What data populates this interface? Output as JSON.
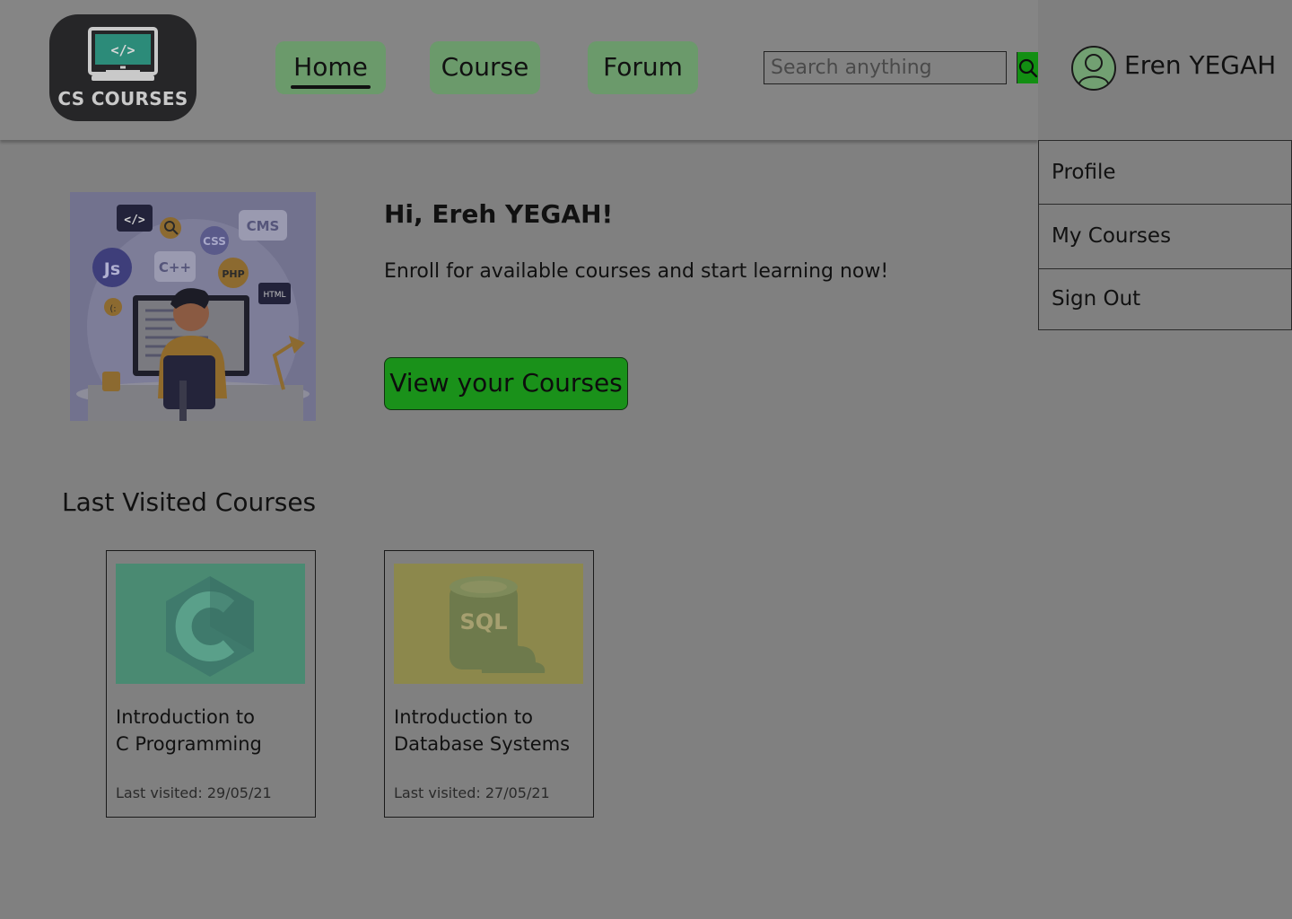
{
  "brand": {
    "logo_text": "CS COURSES"
  },
  "nav": {
    "home": "Home",
    "course": "Course",
    "forum": "Forum"
  },
  "search": {
    "placeholder": "Search anything"
  },
  "user": {
    "name": "Eren YEGAH",
    "menu": [
      "Profile",
      "My Courses",
      "Sign Out"
    ]
  },
  "hero": {
    "greeting": "Hi, Ereh YEGAH!",
    "tagline": "Enroll for available courses and start learning now!",
    "cta": "View your Courses",
    "illustration_labels": [
      "</>",
      "CMS",
      "CSS",
      "Js",
      "C++",
      "PHP",
      "HTML",
      "(:"
    ]
  },
  "last_visited": {
    "title": "Last Visited Courses",
    "courses": [
      {
        "title_line1": "Introduction to",
        "title_line2": "C Programming",
        "visited": "Last visited: 29/05/21",
        "thumb_color": "#4a8a72",
        "thumb_label": "C"
      },
      {
        "title_line1": "Introduction to",
        "title_line2": "Database Systems",
        "visited": "Last visited: 27/05/21",
        "thumb_color": "#8c884c",
        "thumb_label": "SQL"
      }
    ]
  },
  "colors": {
    "nav_button": "#6b9a6b",
    "accent_green": "#1a911a",
    "overlay_gray": "#808080"
  }
}
